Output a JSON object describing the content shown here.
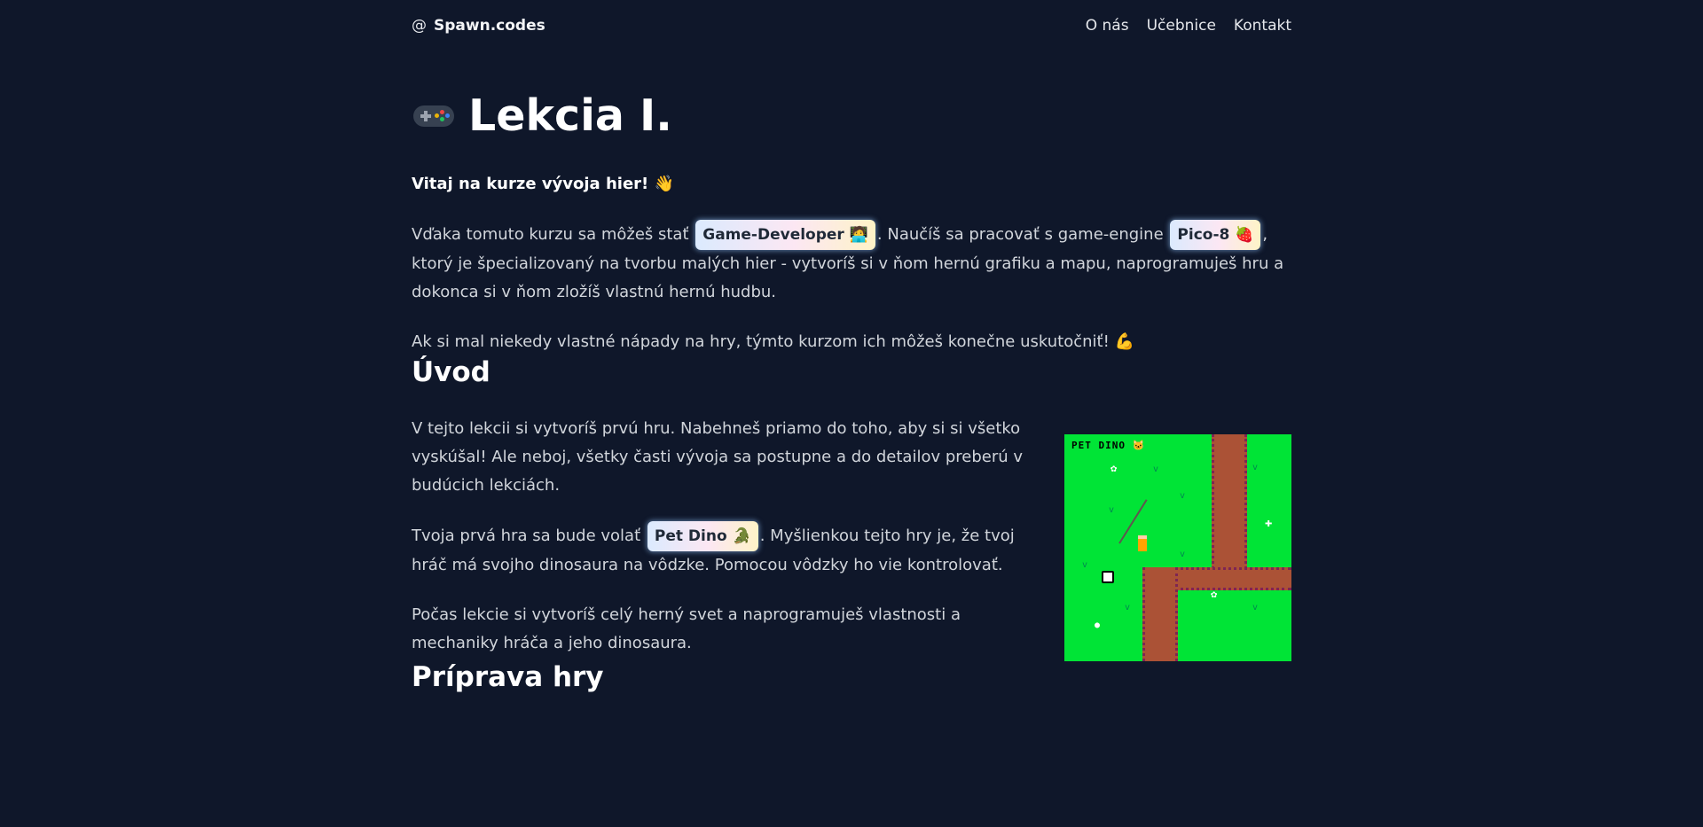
{
  "nav": {
    "brand_icon": "@",
    "brand": "Spawn.codes",
    "links": [
      "O nás",
      "Učebnice",
      "Kontakt"
    ]
  },
  "page": {
    "title_icon": "gamepad-icon",
    "title": "Lekcia I."
  },
  "intro": {
    "welcome": "Vitaj na kurze vývoja hier! 👋",
    "p1_a": "Vďaka tomuto kurzu sa môžeš stať",
    "badge_game_dev": "Game-Developer 🧑‍💻",
    "p1_b": ". Naučíš sa pracovať s game-engine",
    "badge_pico": "Pico-8 🍓",
    "p1_c": ", ktorý je špecializovaný na tvorbu malých hier - vytvoríš si v ňom hernú grafiku a mapu, naprogramuješ hru a dokonca si v ňom zložíš vlastnú hernú hudbu.",
    "p2": "Ak si mal niekedy vlastné nápady na hry, týmto kurzom ich môžeš konečne uskutočniť! 💪"
  },
  "uvod": {
    "heading": "Úvod",
    "p1": "V tejto lekcii si vytvoríš prvú hru. Nabehneš priamo do toho, aby si si všetko vyskúšal! Ale neboj, všetky časti vývoja sa postupne a do detailov preberú v budúcich lekciách.",
    "p2_a": "Tvoja prvá hra sa bude volať",
    "badge_pet_dino": "Pet Dino 🐊",
    "p2_b": ". Myšlienkou tejto hry je, že tvoj hráč má svojho dinosaura na vôdzke. Pomocou vôdzky ho vie kontrolovať.",
    "p3": "Počas lekcie si vytvoríš celý herný svet a naprogramuješ vlastnosti a mechaniky hráča a jeho dinosaura.",
    "screenshot_title": "PET DINO 🐱"
  },
  "priprava": {
    "heading": "Príprava hry"
  },
  "colors": {
    "background": "#0f172a",
    "game_grass": "#00e436",
    "game_path": "#ab5236"
  }
}
